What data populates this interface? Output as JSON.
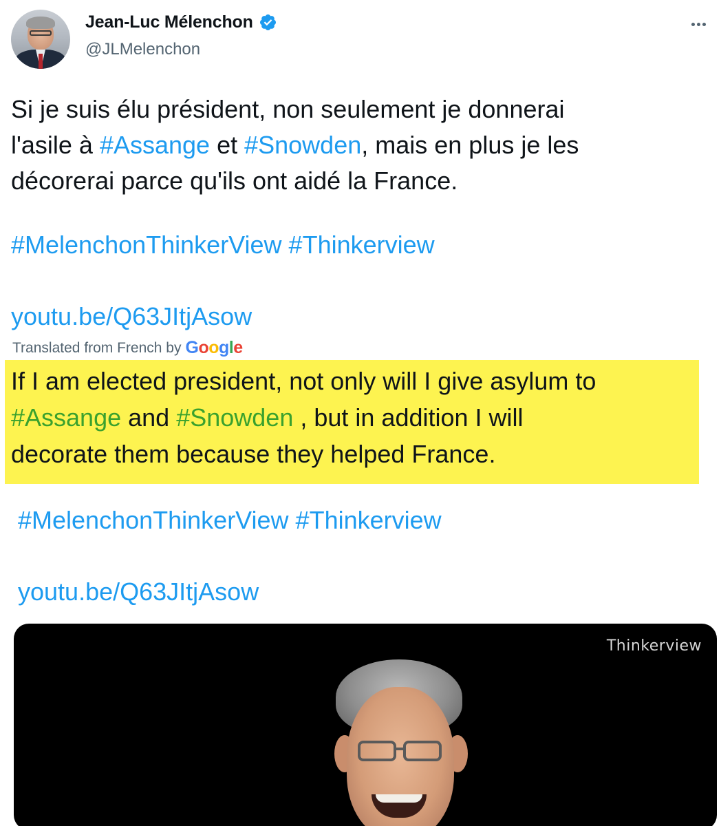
{
  "author": {
    "display_name": "Jean-Luc Mélenchon",
    "handle": "@JLMelenchon",
    "verified": true,
    "avatar_icon": "profile-photo"
  },
  "colors": {
    "link": "#1d9bf0",
    "highlight": "#fdf350",
    "translated_link": "#3aa12e",
    "secondary_text": "#536471"
  },
  "tweet": {
    "line1": "Si je suis élu président, non seulement je donnerai",
    "line2_pre": "l'asile à ",
    "line2_tag1": "#Assange",
    "line2_mid": " et ",
    "line2_tag2": "#Snowden",
    "line2_post": ", mais en plus je les",
    "line3": "décorerai parce qu'ils ont aidé la France.",
    "hashtags": "#MelenchonThinkerView #Thinkerview",
    "link": "youtu.be/Q63JItjAsow"
  },
  "translation": {
    "label": "Translated from French by",
    "provider_g1": "G",
    "provider_o1": "o",
    "provider_o2": "o",
    "provider_g2": "g",
    "provider_l": "l",
    "provider_e": "e",
    "line1": "If I am elected president, not only will I give asylum to",
    "line2_tag1": "#Assange",
    "line2_mid": " and ",
    "line2_tag2": "#Snowden",
    "line2_post": " , but in addition I will",
    "line3": "decorate them because they helped France.",
    "hashtags": "#MelenchonThinkerView #Thinkerview",
    "link": "youtu.be/Q63JItjAsow"
  },
  "media": {
    "watermark": "Thinkerview"
  }
}
